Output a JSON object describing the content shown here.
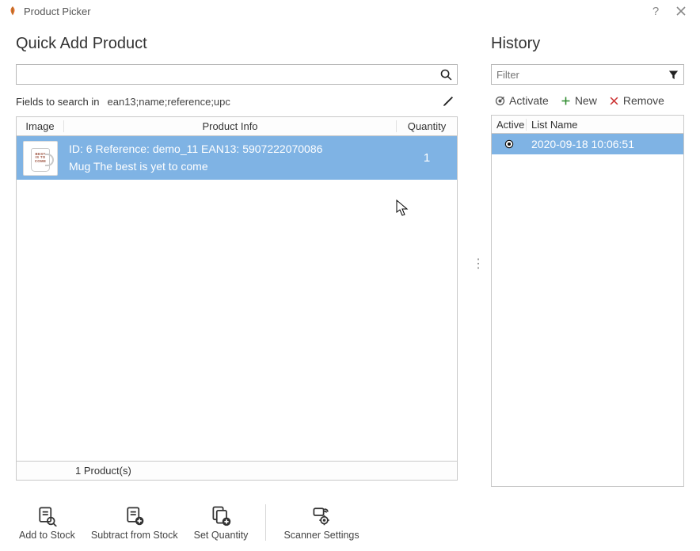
{
  "window": {
    "title": "Product Picker"
  },
  "left": {
    "title": "Quick Add Product",
    "search_value": "",
    "search_placeholder": "",
    "fields_label": "Fields to search in",
    "fields_value": "ean13;name;reference;upc",
    "columns": {
      "image": "Image",
      "info": "Product Info",
      "qty": "Quantity"
    },
    "row": {
      "id": "6",
      "reference": "demo_11",
      "ean13": "5907222070086",
      "line1": "ID: 6 Reference: demo_11 EAN13: 5907222070086",
      "line2": "Mug The best is yet to come",
      "quantity": "1"
    },
    "footer": "1 Product(s)"
  },
  "right": {
    "title": "History",
    "filter_placeholder": "Filter",
    "filter_value": "",
    "actions": {
      "activate": "Activate",
      "new_": "New",
      "remove": "Remove"
    },
    "columns": {
      "active": "Active",
      "name": "List Name"
    },
    "row": {
      "active": true,
      "name": "2020-09-18 10:06:51"
    }
  },
  "toolbar": {
    "add": "Add to Stock",
    "subtract": "Subtract from Stock",
    "setqty": "Set Quantity",
    "scanner": "Scanner Settings"
  }
}
